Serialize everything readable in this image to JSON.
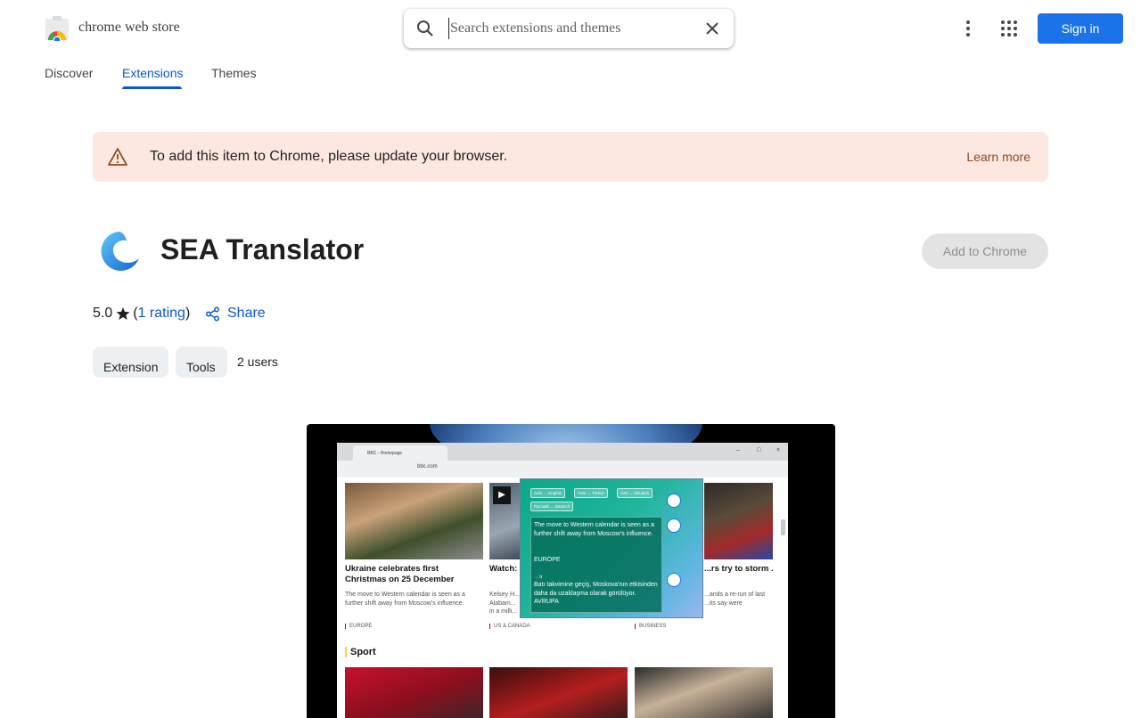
{
  "header": {
    "store_title": "chrome web store",
    "search_placeholder": "Search extensions and themes",
    "sign_in": "Sign in"
  },
  "tabs": [
    "Discover",
    "Extensions",
    "Themes"
  ],
  "active_tab": "Extensions",
  "banner": {
    "message": "To add this item to Chrome, please update your browser.",
    "link": "Learn more"
  },
  "extension": {
    "title": "SEA Translator",
    "add_button": "Add to Chrome",
    "rating": "5.0",
    "rating_count": "1 rating",
    "share": "Share",
    "chips": [
      "Extension",
      "Tools"
    ],
    "users": "2 users"
  },
  "screenshot": {
    "tab_title": "BBC - Homepage",
    "url": "bbc.com",
    "stories": [
      {
        "headline": "Ukraine celebrates first Christmas on 25 December",
        "summary": "The move to Western calendar is seen as a further shift away from Moscow's influence.",
        "tag": "EUROPE"
      },
      {
        "headline": "Watch: mum w...",
        "summary": "Kelsey H... Alabam... in a milli...",
        "tag": "US & CANADA"
      },
      {
        "headline": "...rs try to storm ...all",
        "summary": "...ands a re-run of last ...its say were",
        "tag": "BUSINESS"
      }
    ],
    "sport_heading": "Sport",
    "popup": {
      "language_pairs": [
        "Auto → English",
        "Auto → Türkçe",
        " 4ırN → Deutsch",
        "Русский → Deutsch"
      ],
      "source_text": "The move to Western calendar is seen as a further shift away from Moscow's influence.",
      "source_tag": "EUROPE",
      "target_label": "→ tr",
      "translated_text": "Batı takvimine geçiş, Moskova'nın etkisinden daha da uzaklaşma olarak görülüyor. AVRUPA"
    }
  },
  "colors": {
    "primary": "#1a73e8",
    "link": "#0b57d0",
    "banner_bg": "#fce8e0",
    "banner_link": "#8c4a1b",
    "disabled_bg": "#e3e3e3",
    "chip_bg": "#edf0f3"
  },
  "icons": [
    "chrome-store-logo",
    "search-icon",
    "clear-icon",
    "more-vert-icon",
    "apps-grid-icon",
    "warning-icon",
    "sea-translator-logo",
    "star-icon",
    "share-icon"
  ]
}
